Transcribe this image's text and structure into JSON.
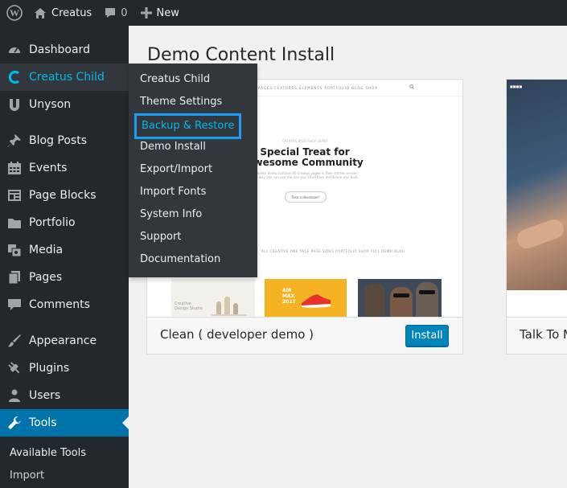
{
  "adminbar": {
    "site_name": "Creatus",
    "comments_count": "0",
    "new_label": "New"
  },
  "sidebar": {
    "items": [
      {
        "label": "Dashboard",
        "icon": "dashboard-icon"
      },
      {
        "label": "Creatus Child",
        "icon": "creatus-c-icon"
      },
      {
        "label": "Unyson",
        "icon": "unyson-icon"
      },
      {
        "label": "Blog Posts",
        "icon": "pin-icon"
      },
      {
        "label": "Events",
        "icon": "calendar-icon"
      },
      {
        "label": "Page Blocks",
        "icon": "blocks-icon"
      },
      {
        "label": "Portfolio",
        "icon": "folder-icon"
      },
      {
        "label": "Media",
        "icon": "media-icon"
      },
      {
        "label": "Pages",
        "icon": "pages-icon"
      },
      {
        "label": "Comments",
        "icon": "comments-icon"
      },
      {
        "label": "Appearance",
        "icon": "brush-icon"
      },
      {
        "label": "Plugins",
        "icon": "plugin-icon"
      },
      {
        "label": "Users",
        "icon": "users-icon"
      },
      {
        "label": "Tools",
        "icon": "wrench-icon"
      }
    ],
    "tools_sub": [
      "Available Tools",
      "Import"
    ]
  },
  "flyout": {
    "items": [
      "Creatus Child",
      "Theme Settings",
      "Backup & Restore",
      "Demo Install",
      "Export/Import",
      "Import Fonts",
      "System Info",
      "Support",
      "Documentation"
    ]
  },
  "main": {
    "title": "Demo Content Install",
    "demos": [
      {
        "name": "Clean ( developer demo )",
        "button": "Install"
      },
      {
        "name": "Talk To M"
      }
    ]
  },
  "preview": {
    "nav": "PAGES    FEATURES    ELEMENTS    PORTFOLIO    BLOG    SHOP",
    "eyebrow": "CREATUS WOO-SHOP DEMO",
    "heading_1": "Special Treat for",
    "heading_2": "Awesome Community",
    "sub_1": "Complete demo contains 40 Creatus pages in their starter version.",
    "sub_2": "This way you can use the one you'll find from the theme was built.",
    "button": "Take a developer!",
    "filters": "ALL   CREATIVE   ONE PAGE   PAGE SIDES   PORTFOLIO   SHOP   FULL DEMO   BLOG",
    "tile1_text_1": "Creative",
    "tile1_text_2": "Design Studio",
    "tile2_text_1": "AIR",
    "tile2_text_2": "MAX",
    "tile2_text_3": "2017"
  },
  "colors": {
    "adminbar_bg": "#23282d",
    "sidebar_bg": "#23282d",
    "flyout_bg": "#32373c",
    "accent": "#00b9eb",
    "current_bg": "#0073aa",
    "highlight_border": "#1b9ff5",
    "button_bg": "#0085ba"
  }
}
